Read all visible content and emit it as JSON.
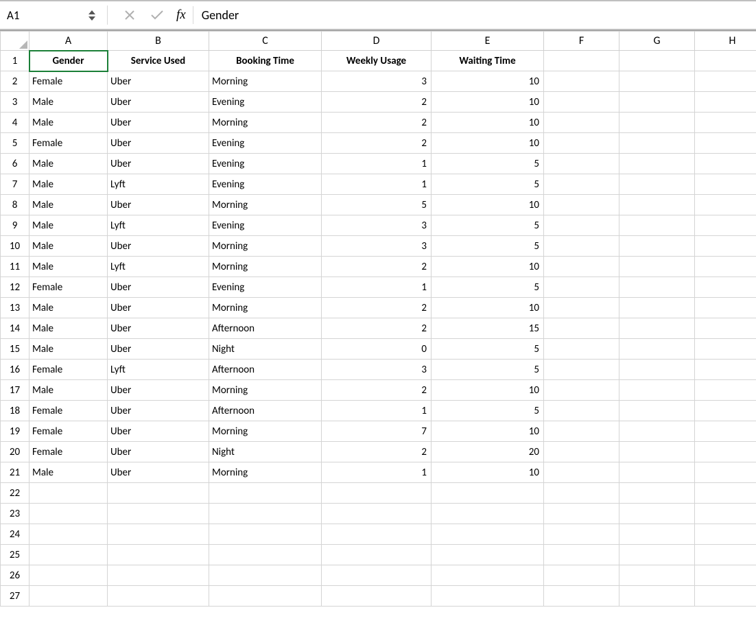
{
  "formula_bar": {
    "cell_ref": "A1",
    "fx_label": "fx",
    "value": "Gender"
  },
  "columns": [
    "A",
    "B",
    "C",
    "D",
    "E",
    "F",
    "G",
    "H"
  ],
  "row_numbers": [
    1,
    2,
    3,
    4,
    5,
    6,
    7,
    8,
    9,
    10,
    11,
    12,
    13,
    14,
    15,
    16,
    17,
    18,
    19,
    20,
    21,
    22,
    23,
    24,
    25,
    26,
    27
  ],
  "headers": [
    "Gender",
    "Service Used",
    "Booking Time",
    "Weekly Usage",
    "Waiting Time"
  ],
  "rows": [
    {
      "gender": "Female",
      "service": "Uber",
      "booking": "Morning",
      "weekly": 3,
      "wait": 10
    },
    {
      "gender": "Male",
      "service": "Uber",
      "booking": "Evening",
      "weekly": 2,
      "wait": 10
    },
    {
      "gender": "Male",
      "service": "Uber",
      "booking": "Morning",
      "weekly": 2,
      "wait": 10
    },
    {
      "gender": "Female",
      "service": "Uber",
      "booking": "Evening",
      "weekly": 2,
      "wait": 10
    },
    {
      "gender": "Male",
      "service": "Uber",
      "booking": "Evening",
      "weekly": 1,
      "wait": 5
    },
    {
      "gender": "Male",
      "service": "Lyft",
      "booking": "Evening",
      "weekly": 1,
      "wait": 5
    },
    {
      "gender": "Male",
      "service": "Uber",
      "booking": "Morning",
      "weekly": 5,
      "wait": 10
    },
    {
      "gender": "Male",
      "service": "Lyft",
      "booking": "Evening",
      "weekly": 3,
      "wait": 5
    },
    {
      "gender": "Male",
      "service": "Uber",
      "booking": "Morning",
      "weekly": 3,
      "wait": 5
    },
    {
      "gender": "Male",
      "service": "Lyft",
      "booking": "Morning",
      "weekly": 2,
      "wait": 10
    },
    {
      "gender": "Female",
      "service": "Uber",
      "booking": "Evening",
      "weekly": 1,
      "wait": 5
    },
    {
      "gender": "Male",
      "service": "Uber",
      "booking": "Morning",
      "weekly": 2,
      "wait": 10
    },
    {
      "gender": "Male",
      "service": "Uber",
      "booking": "Afternoon",
      "weekly": 2,
      "wait": 15
    },
    {
      "gender": "Male",
      "service": "Uber",
      "booking": "Night",
      "weekly": 0,
      "wait": 5
    },
    {
      "gender": "Female",
      "service": "Lyft",
      "booking": "Afternoon",
      "weekly": 3,
      "wait": 5
    },
    {
      "gender": "Male",
      "service": "Uber",
      "booking": "Morning",
      "weekly": 2,
      "wait": 10
    },
    {
      "gender": "Female",
      "service": "Uber",
      "booking": "Afternoon",
      "weekly": 1,
      "wait": 5
    },
    {
      "gender": "Female",
      "service": "Uber",
      "booking": "Morning",
      "weekly": 7,
      "wait": 10
    },
    {
      "gender": "Female",
      "service": "Uber",
      "booking": "Night",
      "weekly": 2,
      "wait": 20
    },
    {
      "gender": "Male",
      "service": "Uber",
      "booking": "Morning",
      "weekly": 1,
      "wait": 10
    }
  ]
}
